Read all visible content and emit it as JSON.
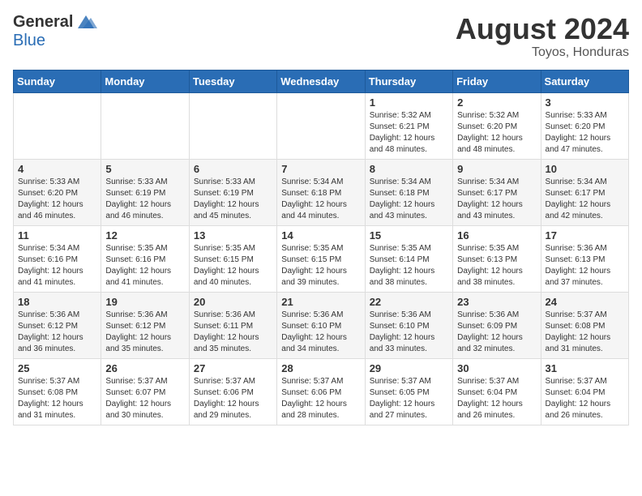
{
  "header": {
    "logo_general": "General",
    "logo_blue": "Blue",
    "month_year": "August 2024",
    "location": "Toyos, Honduras"
  },
  "days_of_week": [
    "Sunday",
    "Monday",
    "Tuesday",
    "Wednesday",
    "Thursday",
    "Friday",
    "Saturday"
  ],
  "weeks": [
    [
      {
        "day": "",
        "info": ""
      },
      {
        "day": "",
        "info": ""
      },
      {
        "day": "",
        "info": ""
      },
      {
        "day": "",
        "info": ""
      },
      {
        "day": "1",
        "info": "Sunrise: 5:32 AM\nSunset: 6:21 PM\nDaylight: 12 hours\nand 48 minutes."
      },
      {
        "day": "2",
        "info": "Sunrise: 5:32 AM\nSunset: 6:20 PM\nDaylight: 12 hours\nand 48 minutes."
      },
      {
        "day": "3",
        "info": "Sunrise: 5:33 AM\nSunset: 6:20 PM\nDaylight: 12 hours\nand 47 minutes."
      }
    ],
    [
      {
        "day": "4",
        "info": "Sunrise: 5:33 AM\nSunset: 6:20 PM\nDaylight: 12 hours\nand 46 minutes."
      },
      {
        "day": "5",
        "info": "Sunrise: 5:33 AM\nSunset: 6:19 PM\nDaylight: 12 hours\nand 46 minutes."
      },
      {
        "day": "6",
        "info": "Sunrise: 5:33 AM\nSunset: 6:19 PM\nDaylight: 12 hours\nand 45 minutes."
      },
      {
        "day": "7",
        "info": "Sunrise: 5:34 AM\nSunset: 6:18 PM\nDaylight: 12 hours\nand 44 minutes."
      },
      {
        "day": "8",
        "info": "Sunrise: 5:34 AM\nSunset: 6:18 PM\nDaylight: 12 hours\nand 43 minutes."
      },
      {
        "day": "9",
        "info": "Sunrise: 5:34 AM\nSunset: 6:17 PM\nDaylight: 12 hours\nand 43 minutes."
      },
      {
        "day": "10",
        "info": "Sunrise: 5:34 AM\nSunset: 6:17 PM\nDaylight: 12 hours\nand 42 minutes."
      }
    ],
    [
      {
        "day": "11",
        "info": "Sunrise: 5:34 AM\nSunset: 6:16 PM\nDaylight: 12 hours\nand 41 minutes."
      },
      {
        "day": "12",
        "info": "Sunrise: 5:35 AM\nSunset: 6:16 PM\nDaylight: 12 hours\nand 41 minutes."
      },
      {
        "day": "13",
        "info": "Sunrise: 5:35 AM\nSunset: 6:15 PM\nDaylight: 12 hours\nand 40 minutes."
      },
      {
        "day": "14",
        "info": "Sunrise: 5:35 AM\nSunset: 6:15 PM\nDaylight: 12 hours\nand 39 minutes."
      },
      {
        "day": "15",
        "info": "Sunrise: 5:35 AM\nSunset: 6:14 PM\nDaylight: 12 hours\nand 38 minutes."
      },
      {
        "day": "16",
        "info": "Sunrise: 5:35 AM\nSunset: 6:13 PM\nDaylight: 12 hours\nand 38 minutes."
      },
      {
        "day": "17",
        "info": "Sunrise: 5:36 AM\nSunset: 6:13 PM\nDaylight: 12 hours\nand 37 minutes."
      }
    ],
    [
      {
        "day": "18",
        "info": "Sunrise: 5:36 AM\nSunset: 6:12 PM\nDaylight: 12 hours\nand 36 minutes."
      },
      {
        "day": "19",
        "info": "Sunrise: 5:36 AM\nSunset: 6:12 PM\nDaylight: 12 hours\nand 35 minutes."
      },
      {
        "day": "20",
        "info": "Sunrise: 5:36 AM\nSunset: 6:11 PM\nDaylight: 12 hours\nand 35 minutes."
      },
      {
        "day": "21",
        "info": "Sunrise: 5:36 AM\nSunset: 6:10 PM\nDaylight: 12 hours\nand 34 minutes."
      },
      {
        "day": "22",
        "info": "Sunrise: 5:36 AM\nSunset: 6:10 PM\nDaylight: 12 hours\nand 33 minutes."
      },
      {
        "day": "23",
        "info": "Sunrise: 5:36 AM\nSunset: 6:09 PM\nDaylight: 12 hours\nand 32 minutes."
      },
      {
        "day": "24",
        "info": "Sunrise: 5:37 AM\nSunset: 6:08 PM\nDaylight: 12 hours\nand 31 minutes."
      }
    ],
    [
      {
        "day": "25",
        "info": "Sunrise: 5:37 AM\nSunset: 6:08 PM\nDaylight: 12 hours\nand 31 minutes."
      },
      {
        "day": "26",
        "info": "Sunrise: 5:37 AM\nSunset: 6:07 PM\nDaylight: 12 hours\nand 30 minutes."
      },
      {
        "day": "27",
        "info": "Sunrise: 5:37 AM\nSunset: 6:06 PM\nDaylight: 12 hours\nand 29 minutes."
      },
      {
        "day": "28",
        "info": "Sunrise: 5:37 AM\nSunset: 6:06 PM\nDaylight: 12 hours\nand 28 minutes."
      },
      {
        "day": "29",
        "info": "Sunrise: 5:37 AM\nSunset: 6:05 PM\nDaylight: 12 hours\nand 27 minutes."
      },
      {
        "day": "30",
        "info": "Sunrise: 5:37 AM\nSunset: 6:04 PM\nDaylight: 12 hours\nand 26 minutes."
      },
      {
        "day": "31",
        "info": "Sunrise: 5:37 AM\nSunset: 6:04 PM\nDaylight: 12 hours\nand 26 minutes."
      }
    ]
  ]
}
